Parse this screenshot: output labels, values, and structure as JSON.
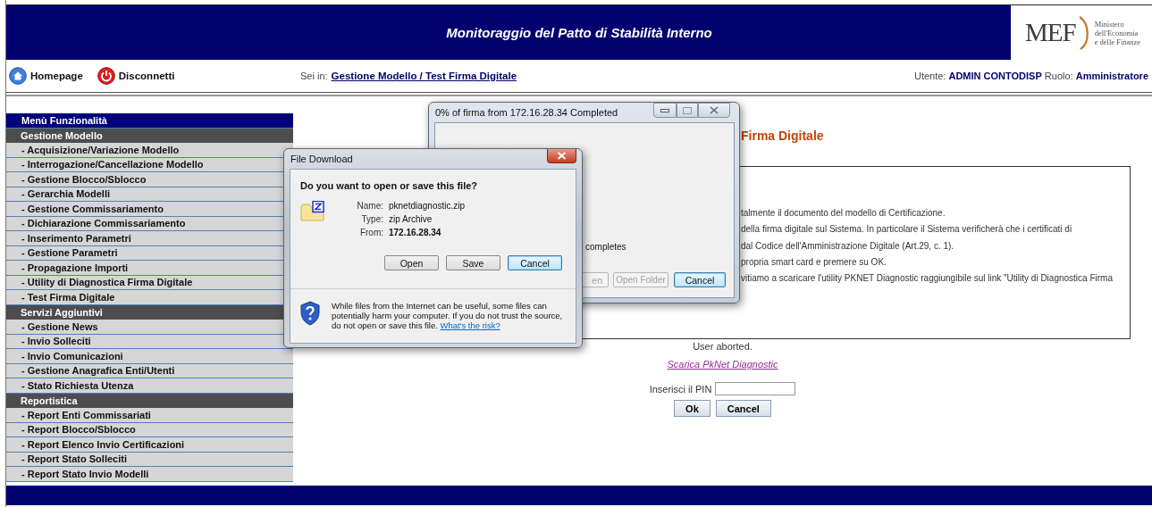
{
  "header": {
    "title": "Monitoraggio del Patto di Stabilità Interno",
    "logo": {
      "mark": "MEF",
      "lines": [
        "Ministero",
        "dell'Economia",
        "e delle Finanze"
      ]
    }
  },
  "nav": {
    "links": [
      {
        "label": "Homepage",
        "kind": "home"
      },
      {
        "label": "Disconnetti",
        "kind": "logout"
      }
    ],
    "breadcrumb_prefix": "Sei in:",
    "breadcrumb": "Gestione Modello / Test Firma Digitale",
    "user_info": "Utente: **ADMIN CONTODISP** Ruolo: **Amministratore**"
  },
  "sidebar": {
    "title": "Menù Funzionalità",
    "sections": [
      {
        "title": "Gestione Modello",
        "items": [
          "- Acquisizione/Variazione Modello",
          "- Interrogazione/Cancellazione Modello",
          "- Gestione Blocco/Sblocco",
          "- Gerarchia Modelli",
          "- Gestione Commissariamento",
          "- Dichiarazione Commissariamento",
          "- Inserimento Parametri",
          "- Gestione Parametri",
          "- Propagazione Importi",
          "- Utility di Diagnostica Firma Digitale",
          "- Test Firma Digitale"
        ]
      },
      {
        "title": "Servizi Aggiuntivi",
        "items": [
          "- Gestione News",
          "- Invio Solleciti",
          "- Invio Comunicazioni",
          "- Gestione Anagrafica Enti/Utenti",
          "- Stato Richiesta Utenza"
        ]
      },
      {
        "title": "Reportistica",
        "items": [
          "- Report Enti Commissariati",
          "- Report Blocco/Sblocco",
          "- Report Elenco Invio Certificazioni",
          "- Report Stato Solleciti",
          "- Report Stato Invio Modelli"
        ]
      }
    ]
  },
  "content": {
    "heading": "Firma Digitale",
    "instructions": [
      "talmente il documento del modello di Certificazione.",
      "della firma digitale sul Sistema. In particolare il Sistema verificherà che i certificati di",
      "dal Codice dell'Amministrazione Digitale (Art.29, c. 1).",
      "propria smart card e premere su OK.",
      "vitiamo a scaricare l'utility PKNET Diagnostic raggiungibile sul link \"Utility di Diagnostica Firma"
    ],
    "status": "User aborted.",
    "download_link": "Scarica PkNet Diagnostic",
    "pin": {
      "label": "Inserisci il PIN"
    },
    "buttons": [
      "Ok",
      "Cancel"
    ]
  },
  "download_progress_dialog": {
    "title": "0% of firma from 172.16.28.34 Completed",
    "status_fragment": "completes",
    "buttons": [
      {
        "label": "en",
        "disabled": true,
        "default": false
      },
      {
        "label": "Open Folder",
        "disabled": true,
        "default": false
      },
      {
        "label": "Cancel",
        "disabled": false,
        "default": true
      }
    ]
  },
  "file_download_dialog": {
    "title": "File Download",
    "question": "Do you want to open or save this file?",
    "fields": [
      {
        "label": "Name:",
        "value": "pknetdiagnostic.zip",
        "bold": false
      },
      {
        "label": "Type:",
        "value": "zip Archive",
        "bold": false
      },
      {
        "label": "From:",
        "value": "172.16.28.34",
        "bold": true
      }
    ],
    "buttons": [
      {
        "label": "Open",
        "default": false
      },
      {
        "label": "Save",
        "default": false
      },
      {
        "label": "Cancel",
        "default": true
      }
    ],
    "warning": "While files from the Internet can be useful, some files can potentially harm your computer. If you do not trust the source, do not open or save this file.",
    "risk_link": "What's the risk?"
  }
}
